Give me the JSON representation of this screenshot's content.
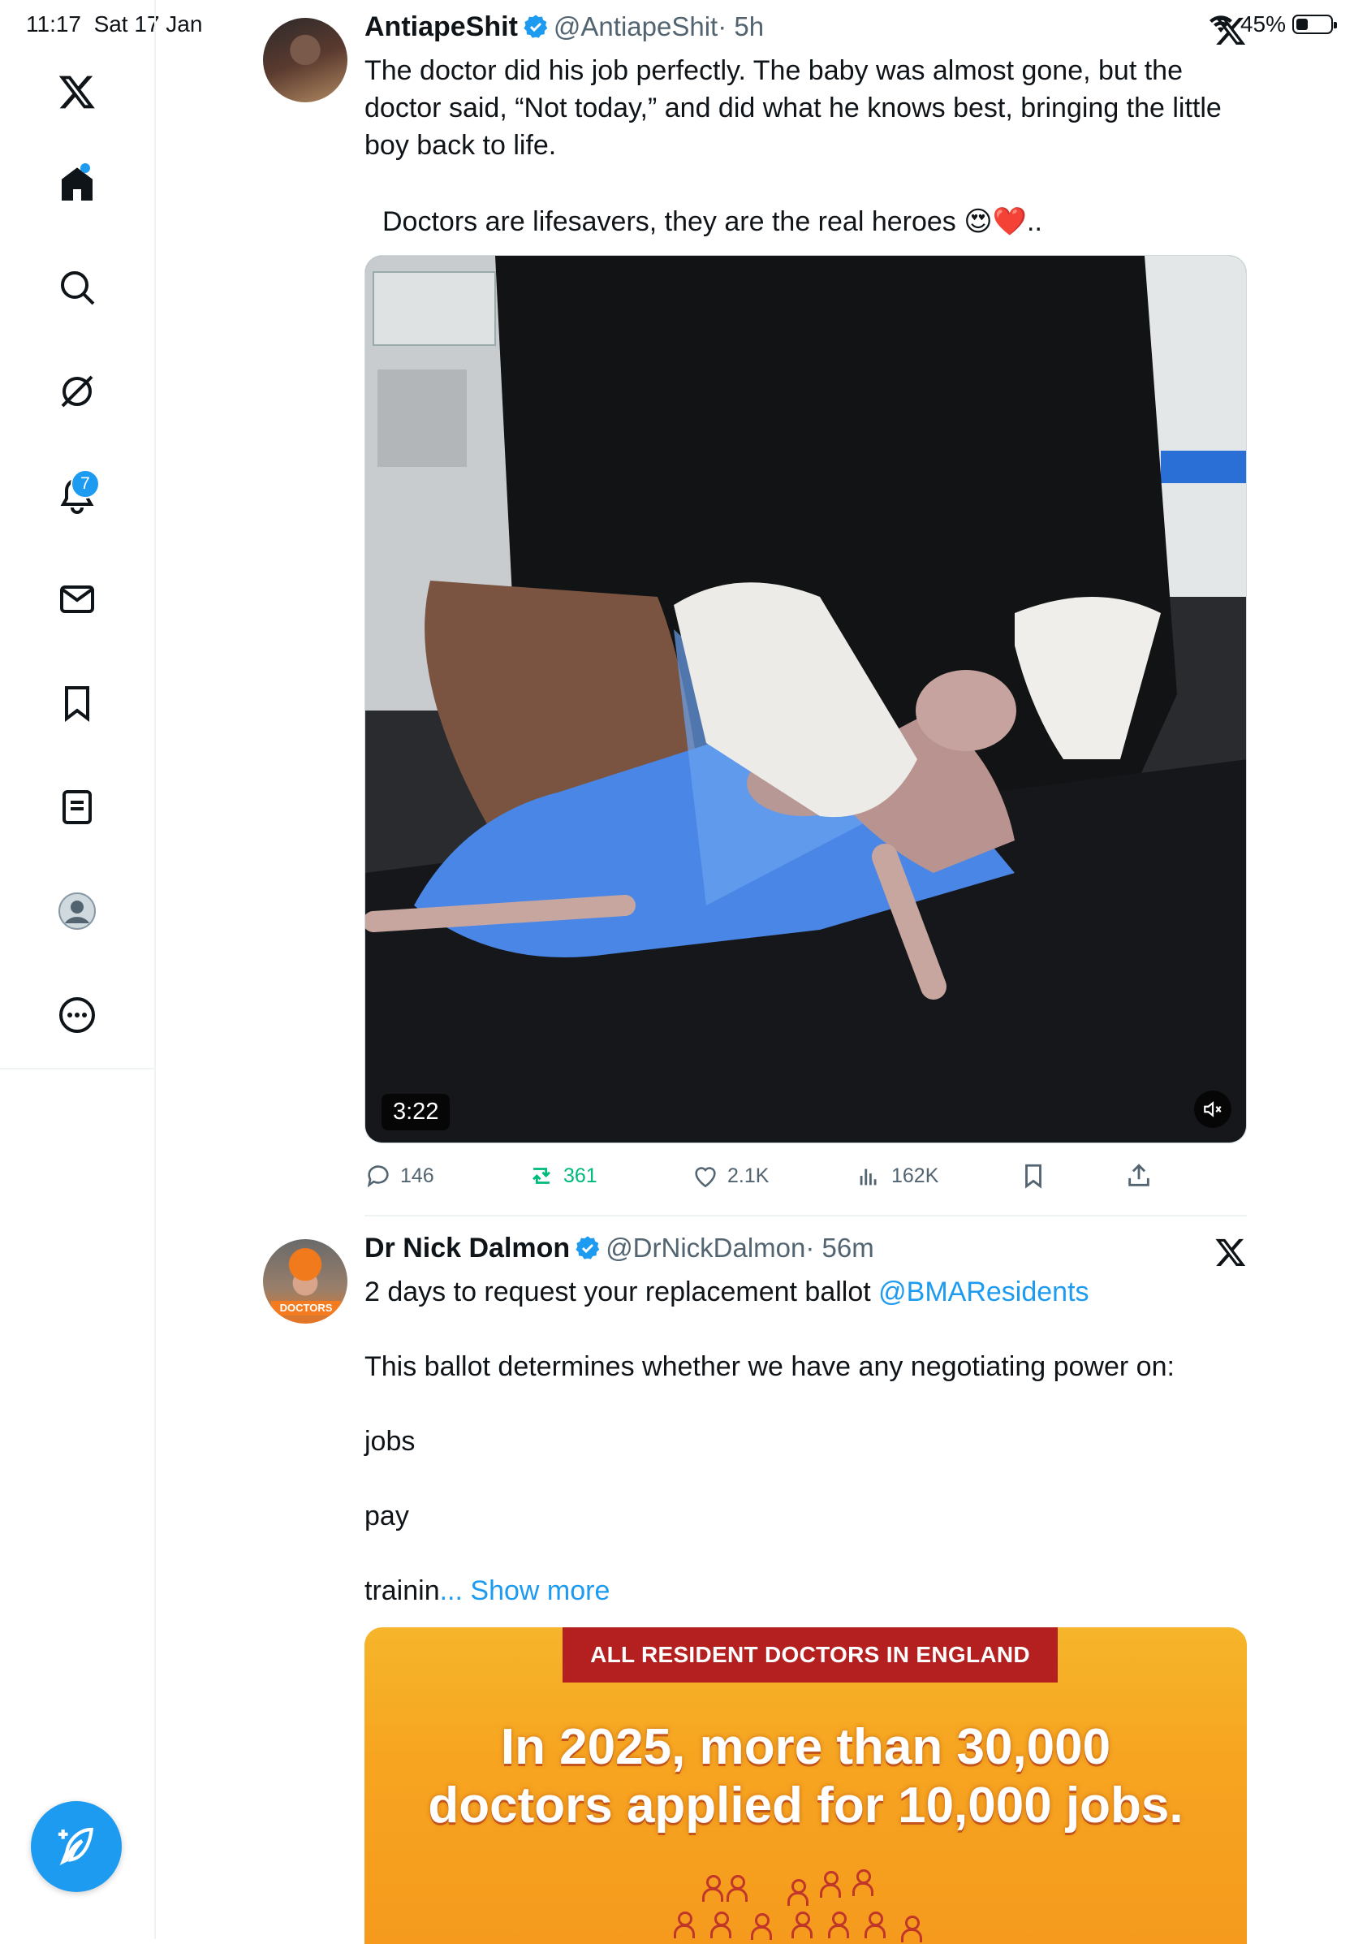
{
  "status_bar": {
    "time": "11:17",
    "date": "Sat 17 Jan",
    "battery": "45%"
  },
  "sidebar": {
    "items": [
      {
        "name": "x-logo"
      },
      {
        "name": "home"
      },
      {
        "name": "search"
      },
      {
        "name": "grok"
      },
      {
        "name": "notifications",
        "badge": "7"
      },
      {
        "name": "messages"
      },
      {
        "name": "bookmarks"
      },
      {
        "name": "lists"
      },
      {
        "name": "profile"
      },
      {
        "name": "more"
      }
    ]
  },
  "tweets": [
    {
      "display_name": "AntiapeShit",
      "handle": "@AntiapeShit",
      "time": "· 5h",
      "verified": true,
      "text": "The doctor did his job perfectly. The baby was almost gone, but the doctor said, “Not today,” and did what he knows best, bringing the little boy back to life.",
      "text2": "Doctors are lifesavers, they are the real heroes 😍❤️..",
      "video": {
        "duration": "3:22"
      },
      "stats": {
        "replies": "146",
        "reposts": "361",
        "likes": "2.1K",
        "views": "162K"
      }
    },
    {
      "display_name": "Dr Nick Dalmon",
      "handle": "@DrNickDalmon",
      "time": "· 56m",
      "verified": true,
      "line1": "2 days to request your replacement ballot ",
      "mention": "@BMAResidents",
      "line2": "This ballot determines whether we have any negotiating power on:",
      "line3": "jobs",
      "line4": "pay",
      "line5": "trainin",
      "show_more": "... Show more",
      "card": {
        "banner": "ALL RESIDENT DOCTORS IN ENGLAND",
        "headline_1": "In 2025, more than 30,000",
        "headline_2": "doctors applied for 10,000 jobs."
      }
    }
  ],
  "colors": {
    "accent": "#1d9bf0",
    "repost_active": "#00ba7c",
    "card_bg": "#f7a521",
    "banner": "#b41f1f"
  }
}
